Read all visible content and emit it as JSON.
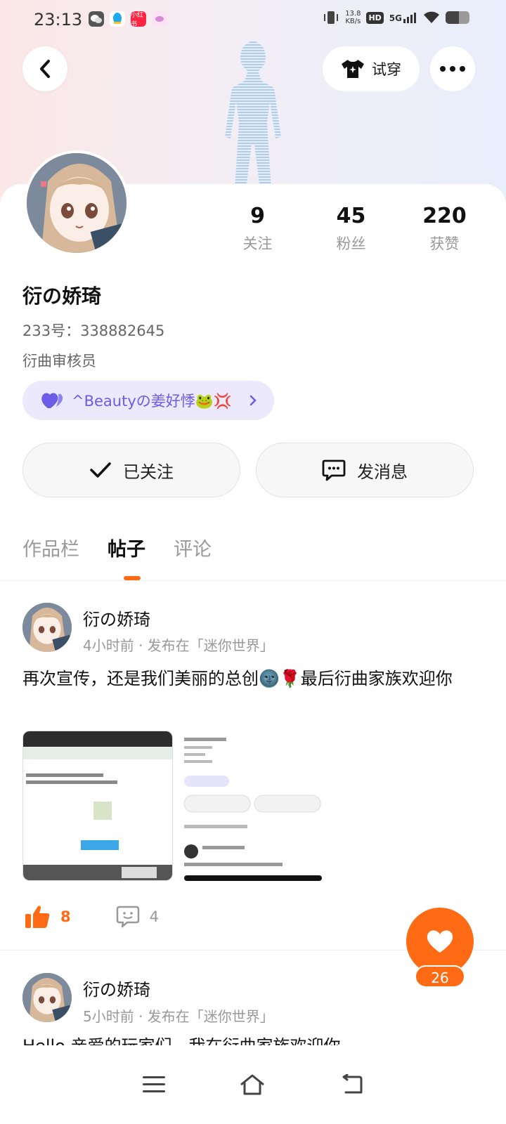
{
  "status_bar": {
    "time": "23:13",
    "apps": [
      {
        "name": "wechat-icon",
        "color": "#555555",
        "label": ""
      },
      {
        "name": "qq-icon",
        "color": "#1eaaf1",
        "label": ""
      },
      {
        "name": "xiaohongshu-icon",
        "color": "#ff2442",
        "label": "小红书"
      },
      {
        "name": "app-icon",
        "color": "#f3c6ea",
        "label": ""
      }
    ],
    "speed_value": "13.8",
    "speed_unit": "KB/s",
    "hd": "HD",
    "network": "5G",
    "battery_level": 0.55
  },
  "header": {
    "tryon_label": "试穿"
  },
  "profile": {
    "stats": [
      {
        "value": "9",
        "label": "关注"
      },
      {
        "value": "45",
        "label": "粉丝"
      },
      {
        "value": "220",
        "label": "获赞"
      }
    ],
    "username": "衍の娇琦",
    "uid": "233号：338882645",
    "role": "衍曲审核员",
    "family_tag": "^Beautyの姜好悸🐸💢"
  },
  "actions": {
    "follow_label": "已关注",
    "message_label": "发消息"
  },
  "tabs": [
    {
      "label": "作品栏",
      "active": false
    },
    {
      "label": "帖子",
      "active": true
    },
    {
      "label": "评论",
      "active": false
    }
  ],
  "posts": [
    {
      "author": "衍の娇琦",
      "meta": "4小时前 · 发布在「迷你世界」",
      "text": "再次宣传，还是我们美丽的总创🌚🌹最后衍曲家族欢迎你",
      "likes": "8",
      "comments": "4"
    },
    {
      "author": "衍の娇琦",
      "meta": "5小时前 · 发布在「迷你世界」",
      "text": "Hello 亲爱的玩家们，我在衍曲家族欢迎你"
    }
  ],
  "fab": {
    "count": "26"
  },
  "colors": {
    "accent": "#ff6a14",
    "purple": "#6c5ce7"
  }
}
